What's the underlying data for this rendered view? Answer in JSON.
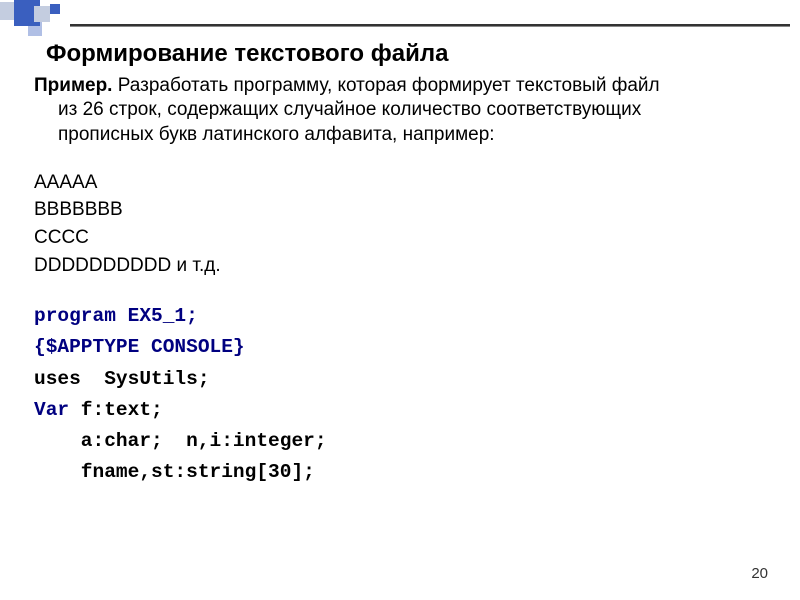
{
  "title": "Формирование текстового файла",
  "task_bold": "Пример.",
  "task_line1_rest": " Разработать программу, которая формирует текстовый файл",
  "task_line2": "из 26 строк, содержащих случайное количество соответствующих",
  "task_line3": "прописных букв латинского алфавита, например:",
  "examples": {
    "l1": "AAAAA",
    "l2": "BBBBBBB",
    "l3": "CCCC",
    "l4": "DDDDDDDDDD и т.д."
  },
  "code": {
    "l1": "program EX5_1;",
    "l2": "{$APPTYPE CONSOLE}",
    "l3": "uses  SysUtils;",
    "l4a": "Var",
    "l4b": " f:text;",
    "l5": "    a:char;  n,i:integer;",
    "l6": "    fname,st:string[30];"
  },
  "page_number": "20"
}
